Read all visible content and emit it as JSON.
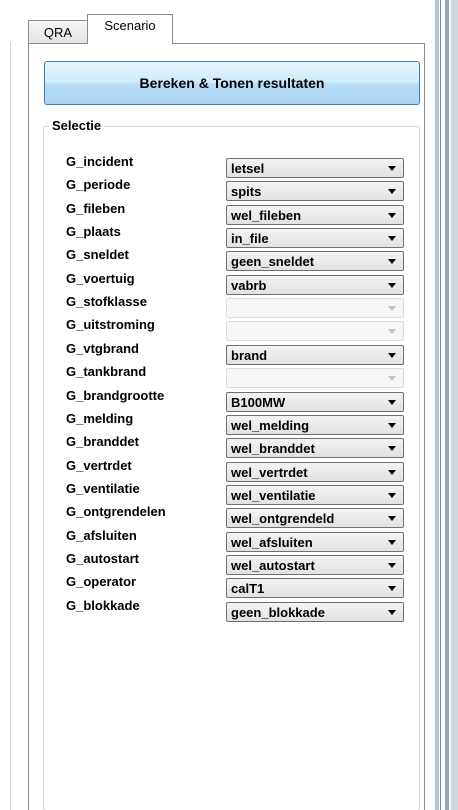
{
  "tabs": [
    {
      "label": "QRA"
    },
    {
      "label": "Scenario"
    }
  ],
  "calc_button_label": "Bereken & Tonen resultaten",
  "group_title": "Selectie",
  "rows": [
    {
      "label": "G_incident",
      "value": "letsel",
      "enabled": true
    },
    {
      "label": "G_periode",
      "value": "spits",
      "enabled": true
    },
    {
      "label": "G_fileben",
      "value": "wel_fileben",
      "enabled": true
    },
    {
      "label": "G_plaats",
      "value": "in_file",
      "enabled": true
    },
    {
      "label": "G_sneldet",
      "value": "geen_sneldet",
      "enabled": true
    },
    {
      "label": "G_voertuig",
      "value": "vabrb",
      "enabled": true
    },
    {
      "label": "G_stofklasse",
      "value": "",
      "enabled": false
    },
    {
      "label": "G_uitstroming",
      "value": "",
      "enabled": false
    },
    {
      "label": "G_vtgbrand",
      "value": "brand",
      "enabled": true
    },
    {
      "label": "G_tankbrand",
      "value": "",
      "enabled": false
    },
    {
      "label": "G_brandgrootte",
      "value": "B100MW",
      "enabled": true
    },
    {
      "label": "G_melding",
      "value": "wel_melding",
      "enabled": true
    },
    {
      "label": "G_branddet",
      "value": "wel_branddet",
      "enabled": true
    },
    {
      "label": "G_vertrdet",
      "value": "wel_vertrdet",
      "enabled": true
    },
    {
      "label": "G_ventilatie",
      "value": "wel_ventilatie",
      "enabled": true
    },
    {
      "label": "G_ontgrendelen",
      "value": "wel_ontgrendeld",
      "enabled": true
    },
    {
      "label": "G_afsluiten",
      "value": "wel_afsluiten",
      "enabled": true
    },
    {
      "label": "G_autostart",
      "value": "wel_autostart",
      "enabled": true
    },
    {
      "label": "G_operator",
      "value": "calT1",
      "enabled": true
    },
    {
      "label": "G_blokkade",
      "value": "geen_blokkade",
      "enabled": true
    }
  ],
  "icons": {
    "dropdown": "chevron-down-icon"
  },
  "colors": {
    "button_border": "#3c7fb1",
    "button_fill": "#bfe0f7",
    "disabled_arrow": "#c4c4c4"
  }
}
